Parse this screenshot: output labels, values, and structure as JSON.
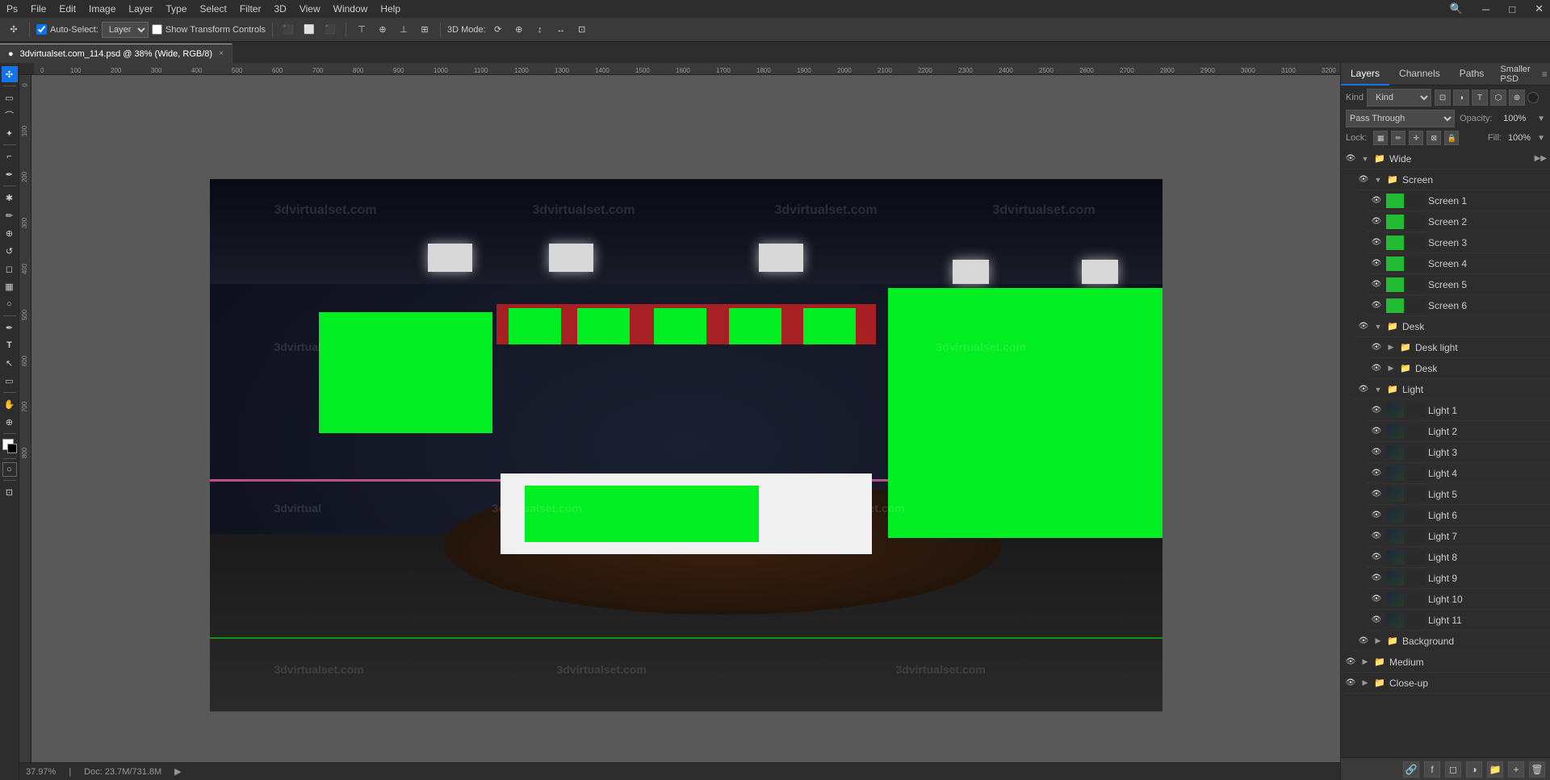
{
  "app": {
    "title": "Adobe Photoshop",
    "menu": [
      "PS",
      "File",
      "Edit",
      "Image",
      "Layer",
      "Type",
      "Select",
      "Filter",
      "3D",
      "View",
      "Window",
      "Help"
    ]
  },
  "toolbar": {
    "auto_select_label": "Auto-Select:",
    "auto_select_checked": true,
    "layer_select": "Layer",
    "show_transform": "Show Transform Controls",
    "mode_3d": "3D Mode:"
  },
  "tab": {
    "filename": "3dvirtualset.com_114.psd @ 38% (Wide, RGB/8)",
    "close_label": "×"
  },
  "layers_panel": {
    "title": "Layers",
    "channels_tab": "Channels",
    "paths_tab": "Paths",
    "smaller_psd_tab": "Smaller PSD",
    "search_placeholder": "Kind",
    "blend_mode": "Pass Through",
    "opacity_label": "Opacity:",
    "opacity_value": "100%",
    "lock_label": "Lock:",
    "fill_label": "Fill:",
    "fill_value": "100%",
    "layers": [
      {
        "id": "wide",
        "name": "Wide",
        "type": "group",
        "indent": 0,
        "visible": true,
        "expanded": true
      },
      {
        "id": "screen-group",
        "name": "Screen",
        "type": "group",
        "indent": 1,
        "visible": true,
        "expanded": true
      },
      {
        "id": "screen1",
        "name": "Screen 1",
        "type": "layer",
        "indent": 2,
        "visible": true
      },
      {
        "id": "screen2",
        "name": "Screen 2",
        "type": "layer",
        "indent": 2,
        "visible": true
      },
      {
        "id": "screen3",
        "name": "Screen 3",
        "type": "layer",
        "indent": 2,
        "visible": true
      },
      {
        "id": "screen4",
        "name": "Screen 4",
        "type": "layer",
        "indent": 2,
        "visible": true
      },
      {
        "id": "screen5",
        "name": "Screen 5",
        "type": "layer",
        "indent": 2,
        "visible": true
      },
      {
        "id": "screen6",
        "name": "Screen 6",
        "type": "layer",
        "indent": 2,
        "visible": true
      },
      {
        "id": "desk-group",
        "name": "Desk",
        "type": "group",
        "indent": 1,
        "visible": true,
        "expanded": true
      },
      {
        "id": "desk-light-group",
        "name": "Desk light",
        "type": "group",
        "indent": 2,
        "visible": true,
        "expanded": false
      },
      {
        "id": "desk-layer",
        "name": "Desk",
        "type": "group",
        "indent": 2,
        "visible": true,
        "expanded": false
      },
      {
        "id": "light-group",
        "name": "Light",
        "type": "group",
        "indent": 1,
        "visible": true,
        "expanded": true
      },
      {
        "id": "light1",
        "name": "Light 1",
        "type": "layer",
        "indent": 2,
        "visible": true
      },
      {
        "id": "light2",
        "name": "Light 2",
        "type": "layer",
        "indent": 2,
        "visible": true
      },
      {
        "id": "light3",
        "name": "Light 3",
        "type": "layer",
        "indent": 2,
        "visible": true
      },
      {
        "id": "light4",
        "name": "Light 4",
        "type": "layer",
        "indent": 2,
        "visible": true
      },
      {
        "id": "light5",
        "name": "Light 5",
        "type": "layer",
        "indent": 2,
        "visible": true
      },
      {
        "id": "light6",
        "name": "Light 6",
        "type": "layer",
        "indent": 2,
        "visible": true
      },
      {
        "id": "light7",
        "name": "Light 7",
        "type": "layer",
        "indent": 2,
        "visible": true
      },
      {
        "id": "light8",
        "name": "Light 8",
        "type": "layer",
        "indent": 2,
        "visible": true
      },
      {
        "id": "light9",
        "name": "Light 9",
        "type": "layer",
        "indent": 2,
        "visible": true
      },
      {
        "id": "light10",
        "name": "Light 10",
        "type": "layer",
        "indent": 2,
        "visible": true
      },
      {
        "id": "light11",
        "name": "Light 11",
        "type": "layer",
        "indent": 2,
        "visible": true
      },
      {
        "id": "background-group",
        "name": "Background",
        "type": "group",
        "indent": 1,
        "visible": true,
        "expanded": false
      },
      {
        "id": "medium-group",
        "name": "Medium",
        "type": "group",
        "indent": 0,
        "visible": true,
        "expanded": false
      },
      {
        "id": "closeup-group",
        "name": "Close-up",
        "type": "group",
        "indent": 0,
        "visible": true,
        "expanded": false
      }
    ]
  },
  "status_bar": {
    "zoom": "37.97%",
    "doc_info": "Doc: 23.7M/731.8M",
    "arrow": "▶"
  },
  "watermarks": [
    "3dvirtualset.com",
    "3dvirtualset.com",
    "3dvirtualset.com",
    "3dvirtualset.com"
  ],
  "tools": [
    {
      "id": "move",
      "symbol": "✣",
      "label": "Move Tool"
    },
    {
      "id": "select-rect",
      "symbol": "▭",
      "label": "Rectangular Marquee Tool"
    },
    {
      "id": "lasso",
      "symbol": "⌒",
      "label": "Lasso Tool"
    },
    {
      "id": "magic-wand",
      "symbol": "✦",
      "label": "Magic Wand Tool"
    },
    {
      "id": "crop",
      "symbol": "⌐",
      "label": "Crop Tool"
    },
    {
      "id": "eyedropper",
      "symbol": "✒",
      "label": "Eyedropper Tool"
    },
    {
      "id": "spot-heal",
      "symbol": "✱",
      "label": "Spot Healing Brush Tool"
    },
    {
      "id": "brush",
      "symbol": "✏",
      "label": "Brush Tool"
    },
    {
      "id": "clone",
      "symbol": "⊕",
      "label": "Clone Stamp Tool"
    },
    {
      "id": "history",
      "symbol": "↺",
      "label": "History Brush Tool"
    },
    {
      "id": "eraser",
      "symbol": "◻",
      "label": "Eraser Tool"
    },
    {
      "id": "gradient",
      "symbol": "▦",
      "label": "Gradient Tool"
    },
    {
      "id": "dodge",
      "symbol": "○",
      "label": "Dodge Tool"
    },
    {
      "id": "pen",
      "symbol": "✒",
      "label": "Pen Tool"
    },
    {
      "id": "type",
      "symbol": "T",
      "label": "Type Tool"
    },
    {
      "id": "path-select",
      "symbol": "↖",
      "label": "Path Selection Tool"
    },
    {
      "id": "shape",
      "symbol": "▭",
      "label": "Shape Tool"
    },
    {
      "id": "hand",
      "symbol": "✋",
      "label": "Hand Tool"
    },
    {
      "id": "zoom",
      "symbol": "⊕",
      "label": "Zoom Tool"
    }
  ]
}
